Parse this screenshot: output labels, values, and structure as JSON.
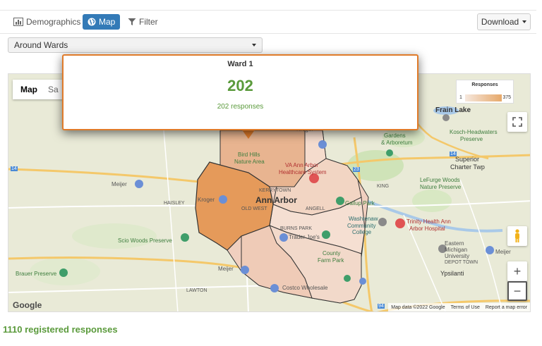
{
  "toolbar": {
    "tabs": [
      {
        "label": "Demographics",
        "icon": "bar-chart-icon"
      },
      {
        "label": "Map",
        "icon": "globe-icon",
        "active": true
      },
      {
        "label": "Filter",
        "icon": "filter-icon"
      }
    ],
    "download_label": "Download"
  },
  "selector": {
    "value": "Around Wards"
  },
  "map": {
    "type_map": "Map",
    "type_satellite": "Sa",
    "legend": {
      "title": "Responses",
      "min": "1",
      "max": "375"
    },
    "labels": {
      "frain_lake": "Frain Lake",
      "kosch": "Kosch-Headwaters",
      "preserve1": "Preserve",
      "superior": "Superior",
      "charter": "Charter Twp",
      "gardens": "Gardens",
      "arboretum": "& Arboretum",
      "kroger1": "Kroger",
      "bird_hills": "Bird Hills",
      "nature_area": "Nature Area",
      "va": "VA Ann Arbor",
      "healthcare": "Healthcare System",
      "meijer1": "Meijer",
      "lefurge": "LeFurge Woods",
      "nature_pres": "Nature Preserve",
      "king": "KING",
      "kerrytown": "KERRYTOWN",
      "haisley": "HAISLEY",
      "kroger2": "Kroger",
      "ann_arbor": "Ann Arbor",
      "old_west": "OLD WEST",
      "angell": "ANGELL",
      "gallup": "Gallup Park",
      "trinity": "Trinity Health Ann",
      "arbor_hosp": "Arbor Hospital",
      "washtenaw": "Washtenaw",
      "community": "Community",
      "college": "College",
      "scio": "Scio Woods Preserve",
      "burns_park": "BURNS PARK",
      "trader_joes": "Trader Joe's",
      "county": "County",
      "farm_park": "Farm Park",
      "eastern": "Eastern",
      "michigan": "Michigan",
      "university": "University",
      "depot": "DEPOT TOWN",
      "ypsilanti": "Ypsilanti",
      "meijer2": "Meijer",
      "meijer3": "Meijer",
      "brauer": "Brauer Preserve",
      "lawton": "LAWTON",
      "costco": "Costco Wholesale",
      "r14a": "14",
      "r14b": "14",
      "r23": "23",
      "r94": "94"
    },
    "attribution": {
      "data": "Map data ©2022 Google",
      "terms": "Terms of Use",
      "report": "Report a map error"
    },
    "logo": "Google",
    "zoom_in": "+",
    "zoom_out": "−"
  },
  "popup": {
    "title": "Ward 1",
    "value": "202",
    "subtitle": "202 responses"
  },
  "footer": {
    "summary": "1110 registered responses"
  },
  "colors": {
    "accent": "#337ab7",
    "popup_border": "#e07b2a",
    "value_green": "#5a9a3b",
    "ward_fill": "#e59a5a"
  }
}
